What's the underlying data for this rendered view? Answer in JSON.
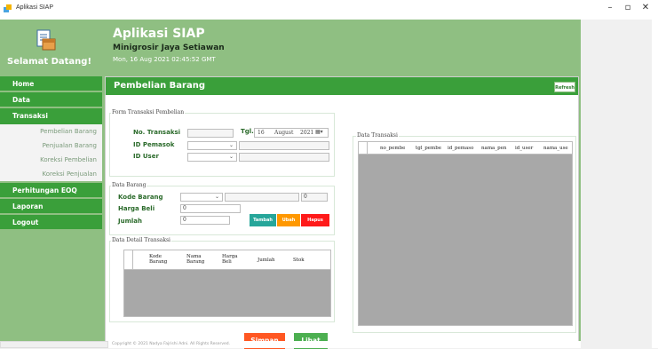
{
  "window": {
    "title": "Aplikasi SIAP",
    "controls": {
      "minimize": "–",
      "restore": "▫",
      "close": "✕"
    }
  },
  "header": {
    "welcome": "Selamat Datang!",
    "app_title": "Aplikasi SIAP",
    "store_name": "Minigrosir Jaya Setiawan",
    "datetime": "Mon, 16 Aug 2021 02:45:52 GMT"
  },
  "sidebar": {
    "items": [
      {
        "label": "Home"
      },
      {
        "label": "Data"
      },
      {
        "label": "Transaksi"
      }
    ],
    "sub_items": [
      {
        "label": "Pembelian Barang"
      },
      {
        "label": "Penjualan Barang"
      },
      {
        "label": "Koreksi Pembelian"
      },
      {
        "label": "Koreksi Penjualan"
      }
    ],
    "items_after": [
      {
        "label": "Perhitungan EOQ"
      },
      {
        "label": "Laporan"
      },
      {
        "label": "Logout"
      }
    ]
  },
  "main": {
    "title": "Pembelian Barang",
    "refresh_label": "Refresh",
    "form_transaksi": {
      "legend": "Form Transaksi Pembelian",
      "no_transaksi_label": "No. Transaksi",
      "no_transaksi_value": "",
      "tgl_label": "Tgl.",
      "date_day": "16",
      "date_month": "August",
      "date_year": "2021",
      "id_pemasok_label": "ID Pemasok",
      "id_user_label": "ID User"
    },
    "data_barang": {
      "legend": "Data Barang",
      "kode_barang_label": "Kode Barang",
      "stok_value": "0",
      "harga_beli_label": "Harga Beli",
      "harga_beli_value": "0",
      "jumlah_label": "Jumlah",
      "jumlah_value": "0",
      "tambah_label": "Tambah",
      "ubah_label": "Ubah",
      "hapus_label": "Hapus"
    },
    "detail": {
      "legend": "Data Detail Transaksi",
      "columns": [
        "Kode Barang",
        "Nama Barang",
        "Harga Beli",
        "Jumlah",
        "Stok"
      ]
    },
    "data_transaksi": {
      "legend": "Data Transaksi",
      "columns": [
        "no_pembe",
        "tgl_pembe",
        "id_pemaso",
        "nama_pen",
        "id_user",
        "nama_use"
      ]
    },
    "simpan_label": "Simpan",
    "lihat_label": "Lihat"
  },
  "footer": {
    "copyright": "Copyright © 2021 Nadya Fajrishi Adni. All Rights Reserved."
  },
  "colors": {
    "header_bg": "#8fbf82",
    "accent_green": "#3a9f3a",
    "tambah": "#26a69a",
    "ubah": "#ff9800",
    "hapus": "#ff1a1a",
    "simpan": "#ff5722",
    "lihat": "#4caf50"
  }
}
